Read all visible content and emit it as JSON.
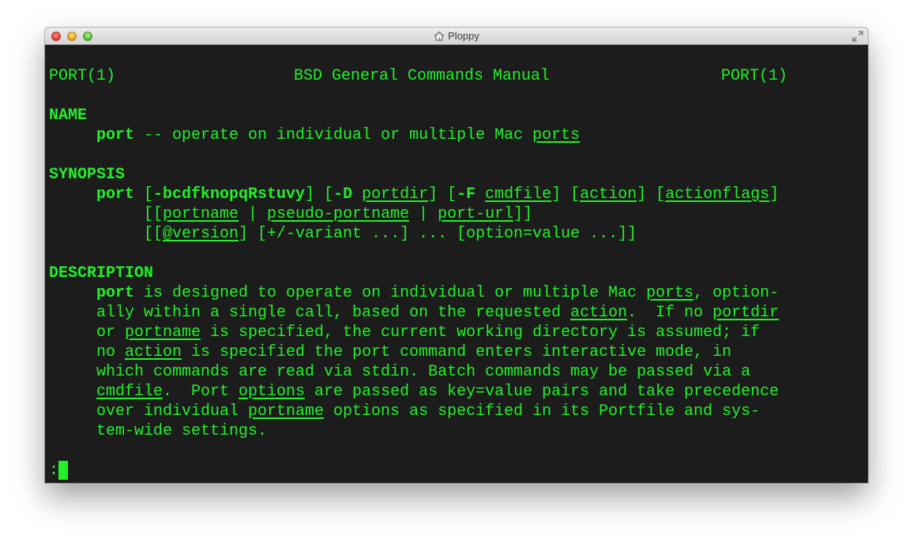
{
  "window": {
    "title": "Ploppy",
    "title_icon": "home-icon",
    "controls": [
      "close-button",
      "minimize-button",
      "zoom-button"
    ],
    "fullscreen_icon": "fullscreen-icon"
  },
  "colors": {
    "terminal_bg": "#1c1c1c",
    "terminal_fg": "#22f02a"
  },
  "man": {
    "header": {
      "left": "PORT(1)",
      "center": "BSD General Commands Manual",
      "right": "PORT(1)"
    },
    "name_heading": "NAME",
    "name_line": {
      "cmd": "port",
      "text": " -- operate on individual or multiple Mac ",
      "link": "ports"
    },
    "synopsis_heading": "SYNOPSIS",
    "synopsis": {
      "l1": {
        "cmd": "port",
        "a": " [",
        "flags": "-bcdfknopqRstuvy",
        "b": "] [",
        "D": "-D",
        "c": " ",
        "portdir": "portdir",
        "d": "] [",
        "F": "-F",
        "e": " ",
        "cmdfile": "cmdfile",
        "f": "] [",
        "action": "action",
        "g": "] [",
        "actionflags": "actionflags",
        "h": "]"
      },
      "l2": {
        "a": "[[",
        "portname": "portname",
        "b": " | ",
        "pseudo": "pseudo-portname",
        "c": " | ",
        "url": "port-url",
        "d": "]]"
      },
      "l3": {
        "a": "[[",
        "version": "@version",
        "b": "] [+/-variant ...] ... [option=value ...]]"
      }
    },
    "description_heading": "DESCRIPTION",
    "description": {
      "l1": {
        "cmd": "port",
        "a": " is designed to operate on individual or multiple Mac ",
        "ports": "ports",
        "b": ", option-"
      },
      "l2": {
        "a": "ally within a single call, based on the requested ",
        "action": "action",
        "b": ".  If no ",
        "portdir": "portdir"
      },
      "l3": {
        "a": "or ",
        "portname": "portname",
        "b": " is specified, the current working directory is assumed; if"
      },
      "l4": {
        "a": "no ",
        "action": "action",
        "b": " is specified the port command enters interactive mode, in"
      },
      "l5": {
        "a": "which commands are read via stdin. Batch commands may be passed via a"
      },
      "l6": {
        "cmdfile": "cmdfile",
        "a": ".  Port ",
        "options": "options",
        "b": " are passed as key=value pairs and take precedence"
      },
      "l7": {
        "a": "over individual ",
        "portname": "portname",
        "b": " options as specified in its Portfile and sys-"
      },
      "l8": {
        "a": "tem-wide settings."
      }
    },
    "prompt": ":"
  }
}
